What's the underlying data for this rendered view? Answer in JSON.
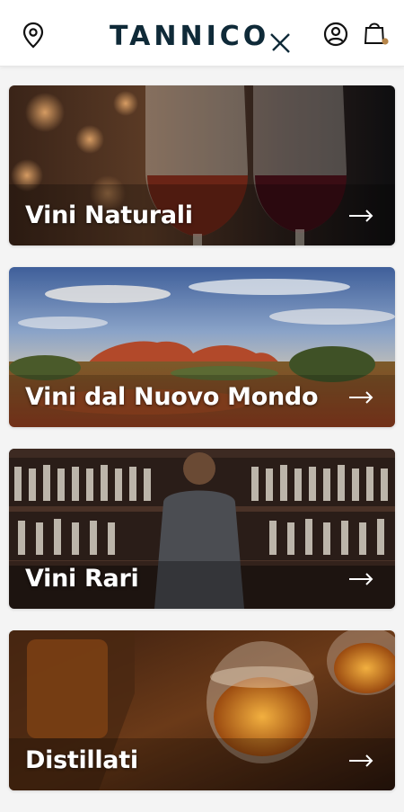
{
  "header": {
    "logo_text": "TANNICO",
    "icons": {
      "location": "map-pin-icon",
      "account": "user-icon",
      "cart": "shopping-bag-icon"
    },
    "cart_badge_color": "#b7864a"
  },
  "categories": [
    {
      "label": "Vini Naturali"
    },
    {
      "label": "Vini dal Nuovo Mondo"
    },
    {
      "label": "Vini Rari"
    },
    {
      "label": "Distillati"
    }
  ],
  "colors": {
    "brand": "#0f2a38",
    "background": "#f4f4f4"
  }
}
